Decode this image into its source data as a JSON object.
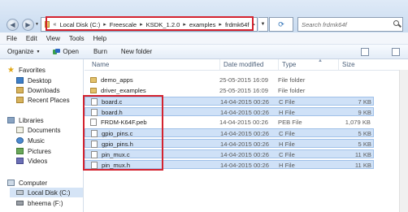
{
  "address": {
    "crumbs": [
      "Local Disk (C:)",
      "Freescale",
      "KSDK_1.2.0",
      "examples",
      "frdmk64f"
    ],
    "overflow_glyph": "«"
  },
  "search": {
    "placeholder": "Search frdmk64f"
  },
  "menu": [
    "File",
    "Edit",
    "View",
    "Tools",
    "Help"
  ],
  "toolbar": {
    "organize": "Organize",
    "open": "Open",
    "burn": "Burn",
    "new_folder": "New folder"
  },
  "nav": {
    "favorites": "Favorites",
    "desktop": "Desktop",
    "downloads": "Downloads",
    "recent": "Recent Places",
    "libraries": "Libraries",
    "documents": "Documents",
    "music": "Music",
    "pictures": "Pictures",
    "videos": "Videos",
    "computer": "Computer",
    "local_disk": "Local Disk (C:)",
    "bheema": "bheema (F:)"
  },
  "columns": {
    "name": "Name",
    "date": "Date modified",
    "type": "Type",
    "size": "Size"
  },
  "files": [
    {
      "name": "demo_apps",
      "date": "25-05-2015 16:09",
      "type": "File folder",
      "size": "",
      "kind": "folder",
      "selected": false
    },
    {
      "name": "driver_examples",
      "date": "25-05-2015 16:09",
      "type": "File folder",
      "size": "",
      "kind": "folder",
      "selected": false
    },
    {
      "name": "board.c",
      "date": "14-04-2015 00:26",
      "type": "C File",
      "size": "7 KB",
      "kind": "file",
      "selected": true
    },
    {
      "name": "board.h",
      "date": "14-04-2015 00:26",
      "type": "H File",
      "size": "9 KB",
      "kind": "file",
      "selected": true
    },
    {
      "name": "FRDM-K64F.peb",
      "date": "14-04-2015 00:26",
      "type": "PEB File",
      "size": "1,079 KB",
      "kind": "file",
      "selected": false
    },
    {
      "name": "gpio_pins.c",
      "date": "14-04-2015 00:26",
      "type": "C File",
      "size": "5 KB",
      "kind": "file",
      "selected": true
    },
    {
      "name": "gpio_pins.h",
      "date": "14-04-2015 00:26",
      "type": "H File",
      "size": "5 KB",
      "kind": "file",
      "selected": true
    },
    {
      "name": "pin_mux.c",
      "date": "14-04-2015 00:26",
      "type": "C File",
      "size": "11 KB",
      "kind": "file",
      "selected": true
    },
    {
      "name": "pin_mux.h",
      "date": "14-04-2015 00:26",
      "type": "H File",
      "size": "11 KB",
      "kind": "file",
      "selected": true
    }
  ],
  "colors": {
    "highlight_box": "#d4232f",
    "selection": "#cfe1f7"
  }
}
